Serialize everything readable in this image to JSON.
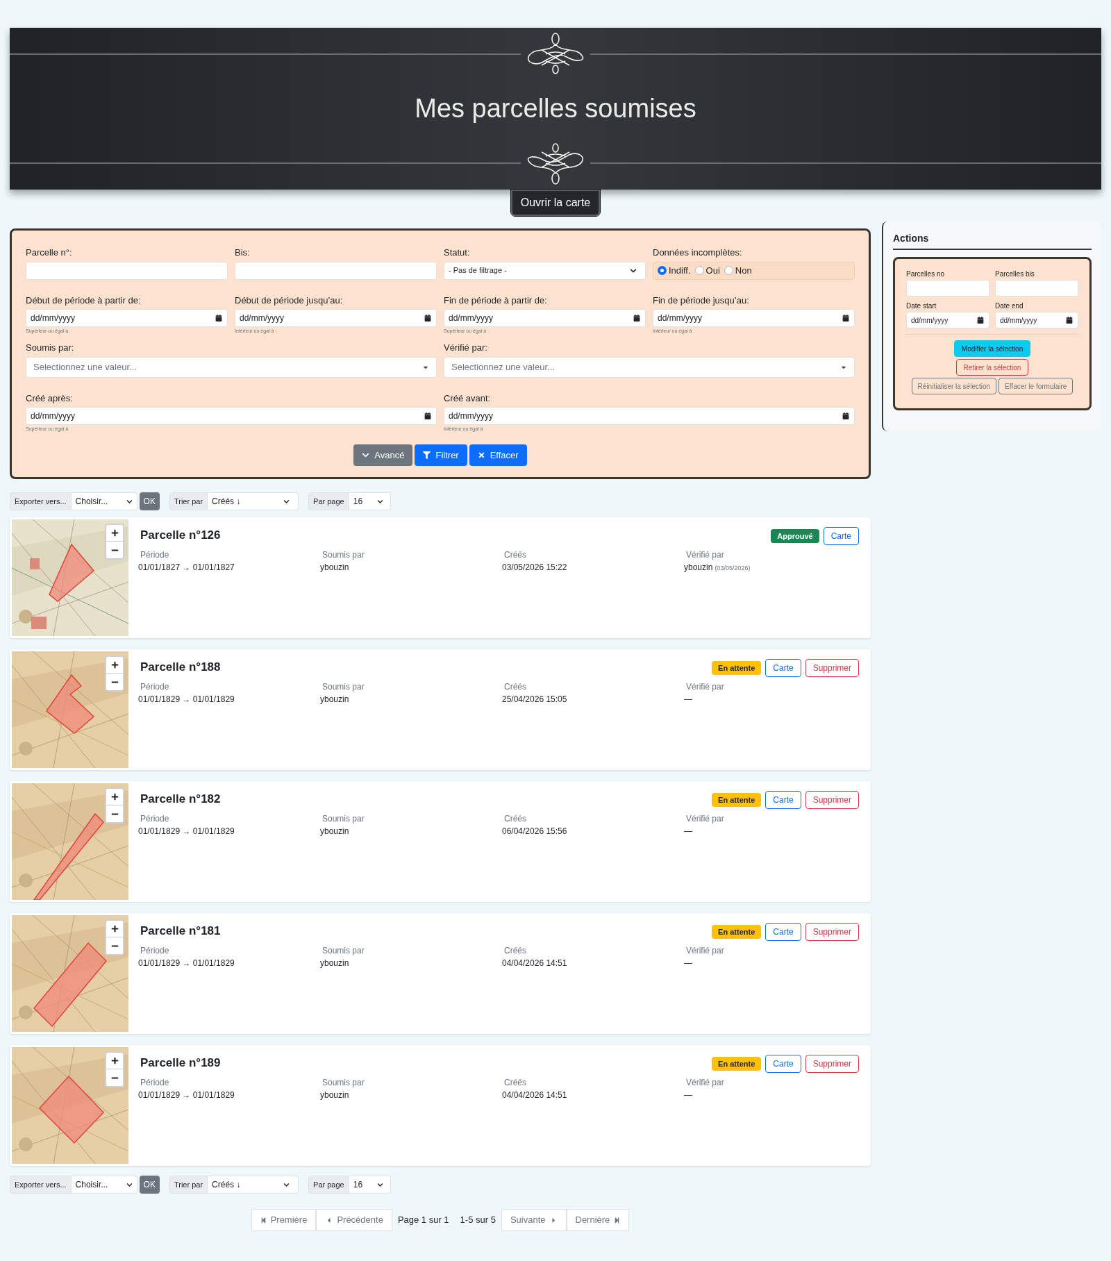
{
  "header": {
    "title": "Mes parcelles soumises",
    "map_button": "Ouvrir la carte"
  },
  "filters": {
    "parcel_no": {
      "label": "Parcelle n°:"
    },
    "bis": {
      "label": "Bis:"
    },
    "status": {
      "label": "Statut:",
      "value": "- Pas de filtrage -"
    },
    "incomplete": {
      "label": "Données incomplètes:",
      "options": [
        {
          "label": "Indiff.",
          "selected": true
        },
        {
          "label": "Oui",
          "selected": false
        },
        {
          "label": "Non",
          "selected": false
        }
      ]
    },
    "dates": [
      {
        "label": "Début de période à partir de:",
        "placeholder": "dd/mm/yyyy",
        "hint": "Supérieur ou égal à"
      },
      {
        "label": "Début de période jusqu’au:",
        "placeholder": "dd/mm/yyyy",
        "hint": "Inférieur ou égal à"
      },
      {
        "label": "Fin de période à partir de:",
        "placeholder": "dd/mm/yyyy",
        "hint": "Supérieur ou égal à"
      },
      {
        "label": "Fin de période jusqu’au:",
        "placeholder": "dd/mm/yyyy",
        "hint": "Inférieur ou égal à"
      }
    ],
    "submitted_by": {
      "label": "Soumis par:",
      "placeholder": "Selectionnez une valeur..."
    },
    "verified_by": {
      "label": "Vérifié par:",
      "placeholder": "Selectionnez une valeur..."
    },
    "created": [
      {
        "label": "Créé après:",
        "placeholder": "dd/mm/yyyy",
        "hint": "Supérieur ou égal à"
      },
      {
        "label": "Créé avant:",
        "placeholder": "dd/mm/yyyy",
        "hint": "Inférieur ou égal à"
      }
    ],
    "buttons": [
      {
        "label": "Avancé",
        "kind": "advanced"
      },
      {
        "label": "Filtrer",
        "kind": "filter"
      },
      {
        "label": "Effacer",
        "kind": "clear"
      }
    ]
  },
  "actions": {
    "title": "Actions",
    "fields": [
      {
        "label": "Parcelles no"
      },
      {
        "label": "Parcelles bis"
      },
      {
        "label": "Date start",
        "placeholder": "dd/mm/yyyy"
      },
      {
        "label": "Date end",
        "placeholder": "dd/mm/yyyy"
      }
    ],
    "buttons": [
      {
        "label": "Modifier la sélection",
        "kind": "primary"
      },
      {
        "label": "Retirer la sélection",
        "kind": "danger"
      },
      {
        "label": "Réinitialiser la sélection",
        "kind": "secondary"
      },
      {
        "label": "Effacer le formulaire",
        "kind": "secondary"
      }
    ]
  },
  "toolbar_top": {
    "export_label": "Exporter vers...",
    "export_value": "Choisir...",
    "ok": "OK",
    "sort_label": "Trier par",
    "sort_value": "Créés ↓",
    "per_page_label": "Par page",
    "per_page_value": "16"
  },
  "parcels": [
    {
      "title": "Parcelle n°126",
      "status": {
        "label": "Approuvé",
        "kind": "approved"
      },
      "buttons": [
        {
          "label": "Carte",
          "kind": "map"
        }
      ],
      "fields": [
        {
          "label": "Période",
          "value": "01/01/1827 → 01/01/1827"
        },
        {
          "label": "Soumis par",
          "value": "ybouzin"
        },
        {
          "label": "Créés",
          "value": "03/05/2026 15:22"
        },
        {
          "label": "Vérifié par",
          "value": "ybouzin",
          "note": "(03/05/2026)"
        }
      ]
    },
    {
      "title": "Parcelle n°188",
      "status": {
        "label": "En attente",
        "kind": "pending"
      },
      "buttons": [
        {
          "label": "Carte",
          "kind": "map"
        },
        {
          "label": "Supprimer",
          "kind": "delete"
        }
      ],
      "fields": [
        {
          "label": "Période",
          "value": "01/01/1829 → 01/01/1829"
        },
        {
          "label": "Soumis par",
          "value": "ybouzin"
        },
        {
          "label": "Créés",
          "value": "25/04/2026 15:05"
        },
        {
          "label": "Vérifié par",
          "value": "—"
        }
      ]
    },
    {
      "title": "Parcelle n°182",
      "status": {
        "label": "En attente",
        "kind": "pending"
      },
      "buttons": [
        {
          "label": "Carte",
          "kind": "map"
        },
        {
          "label": "Supprimer",
          "kind": "delete"
        }
      ],
      "fields": [
        {
          "label": "Période",
          "value": "01/01/1829 → 01/01/1829"
        },
        {
          "label": "Soumis par",
          "value": "ybouzin"
        },
        {
          "label": "Créés",
          "value": "06/04/2026 15:56"
        },
        {
          "label": "Vérifié par",
          "value": "—"
        }
      ]
    },
    {
      "title": "Parcelle n°181",
      "status": {
        "label": "En attente",
        "kind": "pending"
      },
      "buttons": [
        {
          "label": "Carte",
          "kind": "map"
        },
        {
          "label": "Supprimer",
          "kind": "delete"
        }
      ],
      "fields": [
        {
          "label": "Période",
          "value": "01/01/1829 → 01/01/1829"
        },
        {
          "label": "Soumis par",
          "value": "ybouzin"
        },
        {
          "label": "Créés",
          "value": "04/04/2026 14:51"
        },
        {
          "label": "Vérifié par",
          "value": "—"
        }
      ]
    },
    {
      "title": "Parcelle n°189",
      "status": {
        "label": "En attente",
        "kind": "pending"
      },
      "buttons": [
        {
          "label": "Carte",
          "kind": "map"
        },
        {
          "label": "Supprimer",
          "kind": "delete"
        }
      ],
      "fields": [
        {
          "label": "Période",
          "value": "01/01/1829 → 01/01/1829"
        },
        {
          "label": "Soumis par",
          "value": "ybouzin"
        },
        {
          "label": "Créés",
          "value": "04/04/2026 14:51"
        },
        {
          "label": "Vérifié par",
          "value": "—"
        }
      ]
    }
  ],
  "toolbar_bottom": {
    "export_label": "Exporter vers...",
    "export_value": "Choisir...",
    "ok": "OK",
    "sort_label": "Trier par",
    "sort_value": "Créés ↓",
    "per_page_label": "Par page",
    "per_page_value": "16"
  },
  "pagination": [
    {
      "label": "Première",
      "kind": "first"
    },
    {
      "label": "Précédente",
      "kind": "prev"
    },
    {
      "label": "Page 1 sur 1",
      "kind": "text"
    },
    {
      "label": "1-5 sur 5",
      "kind": "text"
    },
    {
      "label": "Suivante",
      "kind": "next"
    },
    {
      "label": "Dernière",
      "kind": "last"
    }
  ]
}
